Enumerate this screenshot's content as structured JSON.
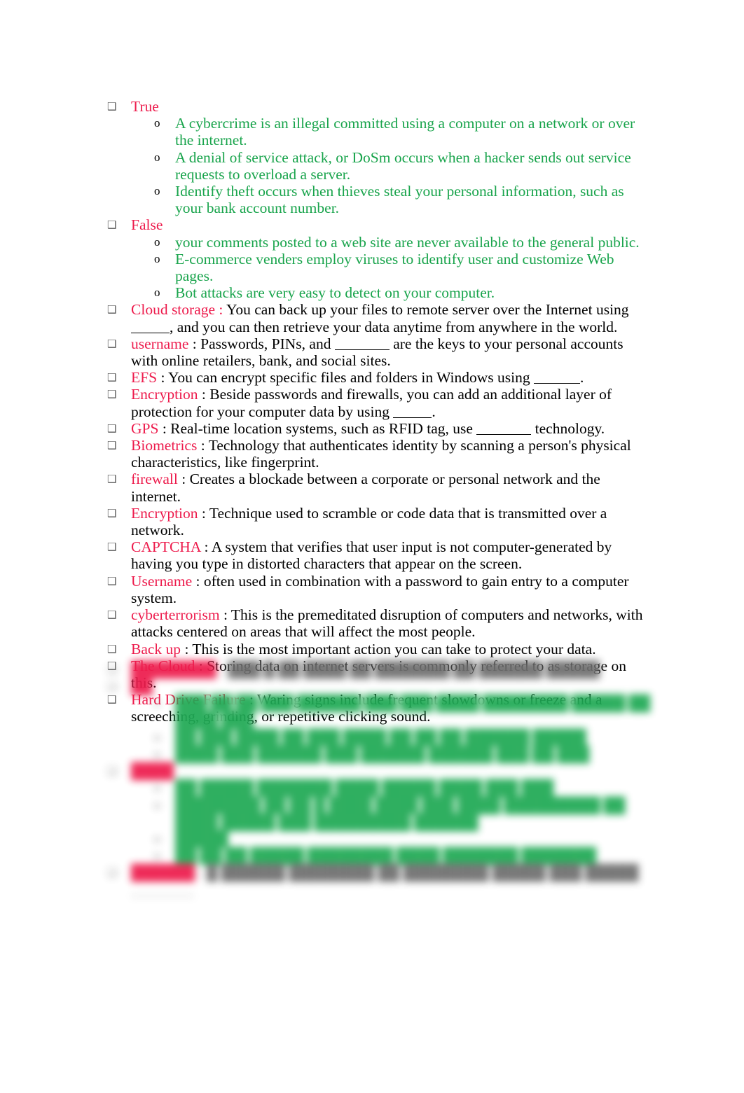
{
  "document": {
    "bullet_glyph": "❑",
    "sub_bullet_glyph": "o",
    "colors": {
      "term_red": "#ED1B4C",
      "answer_green": "#19A44C",
      "body_black": "#000000",
      "bullet_gray": "#595959",
      "page_background": "#FFFFFF"
    }
  },
  "sections": [
    {
      "heading": "True",
      "items": [
        "A cybercrime is an illegal committed using a computer on a network or over the internet.",
        "A denial of service attack, or DoSm occurs when a hacker sends out service requests to overload a server.",
        "Identify theft occurs when thieves steal your personal information, such as your bank account number."
      ]
    },
    {
      "heading": "False",
      "items": [
        "your comments posted to a web site are never available to the general public.",
        "E-commerce venders employ viruses to identify user and customize Web pages.",
        "Bot attacks are very easy to detect on your computer."
      ]
    }
  ],
  "definitions": [
    {
      "term": "Cloud storage",
      "colon_colored": true,
      "text_before": " : You can back up your files to remote server over the Internet using ",
      "blank": "b5",
      "text_after": ", and you can then retrieve your data anytime from anywhere in the world."
    },
    {
      "term": "username",
      "colon_colored": false,
      "text_before": " : Passwords, PINs, and ",
      "blank": "b7",
      "text_after": " are the keys to your personal accounts with online retailers, bank, and social sites."
    },
    {
      "term": "EFS",
      "colon_colored": false,
      "text_before": " : You can encrypt specific files and folders in Windows using ",
      "blank": "b6",
      "text_after": "."
    },
    {
      "term": "Encryption",
      "colon_colored": false,
      "text_before": " : Beside passwords and firewalls, you can add an additional layer of protection for your computer data by using ",
      "blank": "b5",
      "text_after": "."
    },
    {
      "term": "GPS",
      "colon_colored": false,
      "text_before": " : Real-time location systems, such as RFID tag, use ",
      "blank": "b7",
      "text_after": " technology."
    },
    {
      "term": "Biometrics",
      "colon_colored": false,
      "text_before": " : Technology that authenticates identity by scanning a person's physical characteristics, like fingerprint.",
      "blank": "",
      "text_after": ""
    },
    {
      "term": "firewall",
      "colon_colored": false,
      "text_before": " : Creates a blockade between a corporate or personal network and the internet.",
      "blank": "",
      "text_after": ""
    },
    {
      "term": "Encryption",
      "colon_colored": false,
      "text_before": " : Technique used to scramble or code data that is transmitted over a network.",
      "blank": "",
      "text_after": ""
    },
    {
      "term": "CAPTCHA",
      "colon_colored": false,
      "text_before": " : A system that verifies that user input is not computer-generated by having you type in distorted characters that appear on the screen.",
      "blank": "",
      "text_after": ""
    },
    {
      "term": "Username",
      "colon_colored": false,
      "text_before": " : often used in combination with a password to gain entry to a computer system.",
      "blank": "",
      "text_after": ""
    },
    {
      "term": "cyberterrorism",
      "colon_colored": false,
      "text_before": " : This is the premeditated disruption of computers and networks, with attacks centered on areas that will affect the most people.",
      "blank": "",
      "text_after": ""
    },
    {
      "term": "Back up",
      "colon_colored": false,
      "text_before": " : This is the most important action you can take to protect your data.",
      "blank": "",
      "text_after": ""
    },
    {
      "term": "The Cloud",
      "colon_colored": false,
      "text_before": " : Storing data on internet servers is commonly referred to as storage on this.",
      "blank": "",
      "text_after": ""
    },
    {
      "term": "Hard Drive Failure",
      "colon_colored": false,
      "text_before": " : Waring signs include frequent slowdowns or freeze and a screeching, grinding, or repetitive clicking sound.",
      "blank": "",
      "text_after": ""
    }
  ],
  "redacted": {
    "note": "Bottom portion of the page is blurred and unreadable.",
    "lines": [
      {
        "kind": "definition",
        "term": "████████",
        "body": "███ █ ██ ████ ██ ███████ ██ ██████ █████"
      },
      {
        "kind": "heading",
        "term": "██",
        "body": ""
      },
      {
        "kind": "sub",
        "body": "███ ██ ██ ███ ██████ ███ ███ ████ ████████ █████ ██ ████ ███"
      },
      {
        "kind": "sub",
        "body": "██ ███ ████ ██ ███ ████ ██ ██ ██ ██████ █████"
      },
      {
        "kind": "sub",
        "body": "████ ███ ██████ ███ ██████ ██████ ███ ██ ███"
      },
      {
        "kind": "heading",
        "term": "████",
        "body": ""
      },
      {
        "kind": "sub",
        "body": "██ █████ ███████ ████ █████ ████ ███ ███"
      },
      {
        "kind": "sub",
        "body": "████████ ██ ██ █ ████ ████ ███ ████ █████████ ██ ████ █████ ███ █████████ ██████"
      },
      {
        "kind": "sub",
        "body": "█████"
      },
      {
        "kind": "sub",
        "body": "██ ██ ██ █████ ████████ ████ ███████ ███████"
      },
      {
        "kind": "definition",
        "term": "██████",
        "body": "█ ██████ ████████ ██ ████████ █████ ███ █████"
      }
    ]
  }
}
